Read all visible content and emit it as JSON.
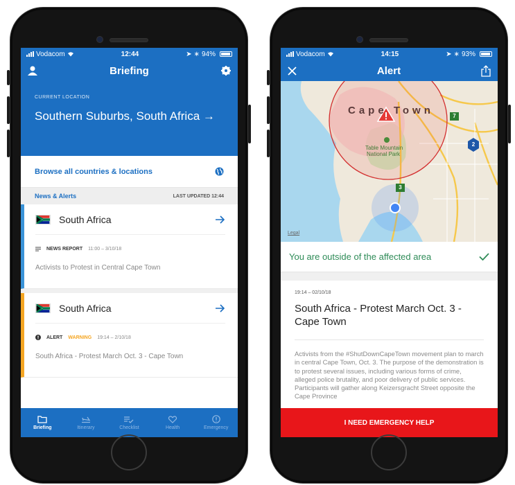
{
  "left_phone": {
    "status": {
      "carrier": "Vodacom",
      "time": "12:44",
      "battery": "94%",
      "battery_level": 0.94
    },
    "nav": {
      "title": "Briefing"
    },
    "location": {
      "caption": "CURRENT LOCATION",
      "name": "Southern Suburbs, South Africa →"
    },
    "browse_label": "Browse all countries & locations",
    "section": {
      "title": "News & Alerts",
      "updated": "LAST UPDATED 12:44"
    },
    "cards": [
      {
        "country": "South Africa",
        "kind": "NEWS REPORT",
        "severity": "",
        "time": "11:00 – 3/10/18",
        "snippet": "Activists to Protest in Central Cape Town"
      },
      {
        "country": "South Africa",
        "kind": "ALERT",
        "severity": "WARNING",
        "time": "19:14 – 2/10/18",
        "snippet": "South Africa - Protest March Oct. 3 - Cape Town"
      }
    ],
    "tabs": [
      {
        "label": "Briefing",
        "icon": "folder-icon"
      },
      {
        "label": "Itinerary",
        "icon": "plane-icon"
      },
      {
        "label": "Checklist",
        "icon": "checklist-icon"
      },
      {
        "label": "Health",
        "icon": "heart-icon"
      },
      {
        "label": "Emergency",
        "icon": "alert-circle-icon"
      }
    ]
  },
  "right_phone": {
    "status": {
      "carrier": "Vodacom",
      "time": "14:15",
      "battery": "93%",
      "battery_level": 0.93
    },
    "nav": {
      "title": "Alert"
    },
    "map": {
      "city_label": "Cape Town",
      "park_label_1": "Table Mountain",
      "park_label_2": "National Park",
      "legal": "Legal",
      "route_a": "7",
      "route_b": "2",
      "route_c": "3"
    },
    "status_line": "You are outside of the affected area",
    "article": {
      "date": "19:14 – 02/10/18",
      "headline": "South Africa - Protest March Oct. 3 - Cape Town",
      "body": "Activists from the #ShutDownCapeTown movement plan to march in central Cape Town, Oct. 3. The purpose of the demonstration is to protest several issues, including various forms of crime, alleged police brutality, and poor delivery of public services. Participants will gather along Keizersgracht Street opposite the Cape Province"
    },
    "emergency_label": "I NEED EMERGENCY HELP"
  },
  "colors": {
    "primary": "#1c6fc2",
    "alert_red": "#e8161a",
    "warning": "#f5a623",
    "success": "#2e8b57"
  }
}
